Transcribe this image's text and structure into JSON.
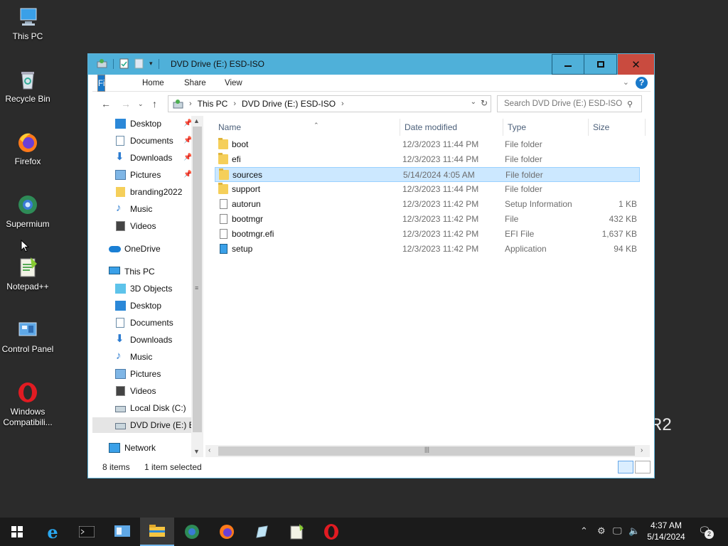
{
  "desktop": {
    "icons": [
      {
        "label": "This PC"
      },
      {
        "label": "Recycle Bin"
      },
      {
        "label": "Firefox"
      },
      {
        "label": "Supermium"
      },
      {
        "label": "Notepad++"
      },
      {
        "label": "Control Panel"
      },
      {
        "label": "Windows Compatibili..."
      }
    ],
    "watermark": "R2"
  },
  "window": {
    "title": "DVD Drive (E:) ESD-ISO",
    "ribbon_tabs": [
      "File",
      "Home",
      "Share",
      "View"
    ],
    "help": "?",
    "address": {
      "crumbs": [
        "This PC",
        "DVD Drive (E:) ESD-ISO"
      ]
    },
    "search_placeholder": "Search DVD Drive (E:) ESD-ISO"
  },
  "nav_pane": {
    "quick_access": [
      {
        "label": "Desktop",
        "pinned": true
      },
      {
        "label": "Documents",
        "pinned": true
      },
      {
        "label": "Downloads",
        "pinned": true
      },
      {
        "label": "Pictures",
        "pinned": true
      },
      {
        "label": "branding2022",
        "pinned": false
      },
      {
        "label": "Music",
        "pinned": false
      },
      {
        "label": "Videos",
        "pinned": false
      }
    ],
    "onedrive": "OneDrive",
    "this_pc": "This PC",
    "this_pc_items": [
      "3D Objects",
      "Desktop",
      "Documents",
      "Downloads",
      "Music",
      "Pictures",
      "Videos",
      "Local Disk (C:)",
      "DVD Drive (E:) ESD-ISO"
    ],
    "network": "Network"
  },
  "file_list": {
    "columns": [
      "Name",
      "Date modified",
      "Type",
      "Size"
    ],
    "rows": [
      {
        "name": "boot",
        "date": "12/3/2023 11:44 PM",
        "type": "File folder",
        "size": "",
        "kind": "folder"
      },
      {
        "name": "efi",
        "date": "12/3/2023 11:44 PM",
        "type": "File folder",
        "size": "",
        "kind": "folder"
      },
      {
        "name": "sources",
        "date": "5/14/2024 4:05 AM",
        "type": "File folder",
        "size": "",
        "kind": "folder",
        "selected": true
      },
      {
        "name": "support",
        "date": "12/3/2023 11:44 PM",
        "type": "File folder",
        "size": "",
        "kind": "folder"
      },
      {
        "name": "autorun",
        "date": "12/3/2023 11:42 PM",
        "type": "Setup Information",
        "size": "1 KB",
        "kind": "inf"
      },
      {
        "name": "bootmgr",
        "date": "12/3/2023 11:42 PM",
        "type": "File",
        "size": "432 KB",
        "kind": "file"
      },
      {
        "name": "bootmgr.efi",
        "date": "12/3/2023 11:42 PM",
        "type": "EFI File",
        "size": "1,637 KB",
        "kind": "file"
      },
      {
        "name": "setup",
        "date": "12/3/2023 11:42 PM",
        "type": "Application",
        "size": "94 KB",
        "kind": "app"
      }
    ]
  },
  "status_bar": {
    "count": "8 items",
    "selected": "1 item selected"
  },
  "taskbar": {
    "time": "4:37 AM",
    "date": "5/14/2024",
    "notifications": "2"
  },
  "colors": {
    "title": "#4fb0d9",
    "file_tab": "#1979ca",
    "close": "#c94b3f",
    "selection": "#cce8ff"
  }
}
